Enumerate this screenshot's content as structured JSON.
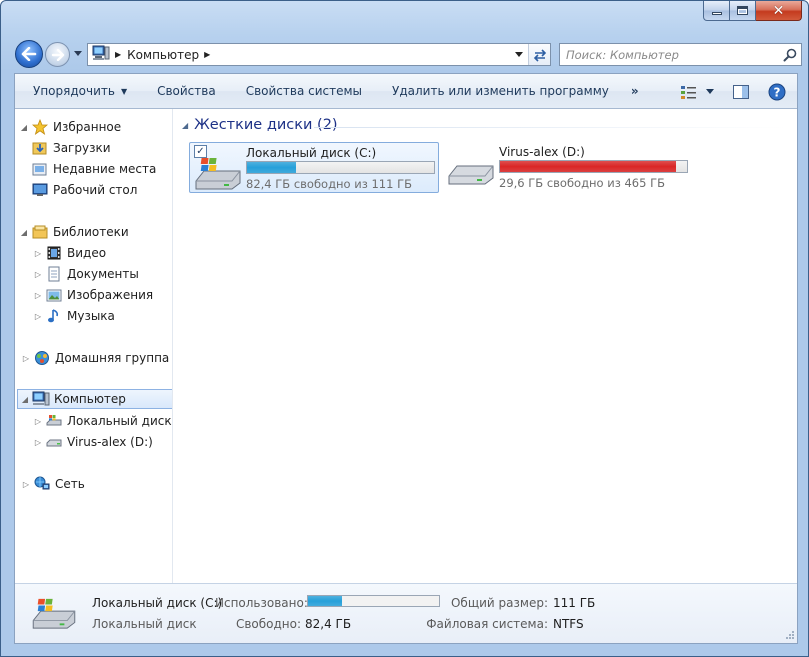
{
  "window": {
    "minimize_glyph": "minimize",
    "maximize_glyph": "maximize",
    "close_glyph": "✕"
  },
  "address": {
    "crumb": "Компьютер",
    "search_placeholder": "Поиск: Компьютер"
  },
  "toolbar": {
    "organize": "Упорядочить",
    "properties": "Свойства",
    "system_properties": "Свойства системы",
    "uninstall": "Удалить или изменить программу",
    "more": "»"
  },
  "navpane": {
    "favorites": "Избранное",
    "downloads": "Загрузки",
    "recent": "Недавние места",
    "desktop": "Рабочий стол",
    "libraries": "Библиотеки",
    "video": "Видео",
    "documents": "Документы",
    "images": "Изображения",
    "music": "Музыка",
    "homegroup": "Домашняя группа",
    "computer": "Компьютер",
    "local_disk": "Локальный диск (C:)",
    "virus_disk": "Virus-alex (D:)",
    "network": "Сеть"
  },
  "content": {
    "group_title": "Жесткие диски (2)",
    "drives": [
      {
        "name": "Локальный диск (C:)",
        "free_text": "82,4 ГБ свободно из 111 ГБ",
        "used_fraction": 0.26,
        "bar_color": "#26a0da",
        "selected": true
      },
      {
        "name": "Virus-alex (D:)",
        "free_text": "29,6 ГБ свободно из 465 ГБ",
        "used_fraction": 0.94,
        "bar_color": "#da2626",
        "selected": false
      }
    ]
  },
  "details": {
    "name": "Локальный диск (C:)",
    "type": "Локальный диск",
    "used_label": "Использовано:",
    "used_fraction": 0.26,
    "free_label": "Свободно:",
    "free_value": "82,4 ГБ",
    "total_label": "Общий размер:",
    "total_value": "111 ГБ",
    "fs_label": "Файловая система:",
    "fs_value": "NTFS"
  },
  "colors": {
    "accent": "#1e3287",
    "bar_blue": "#26a0da",
    "bar_red": "#da2626"
  }
}
